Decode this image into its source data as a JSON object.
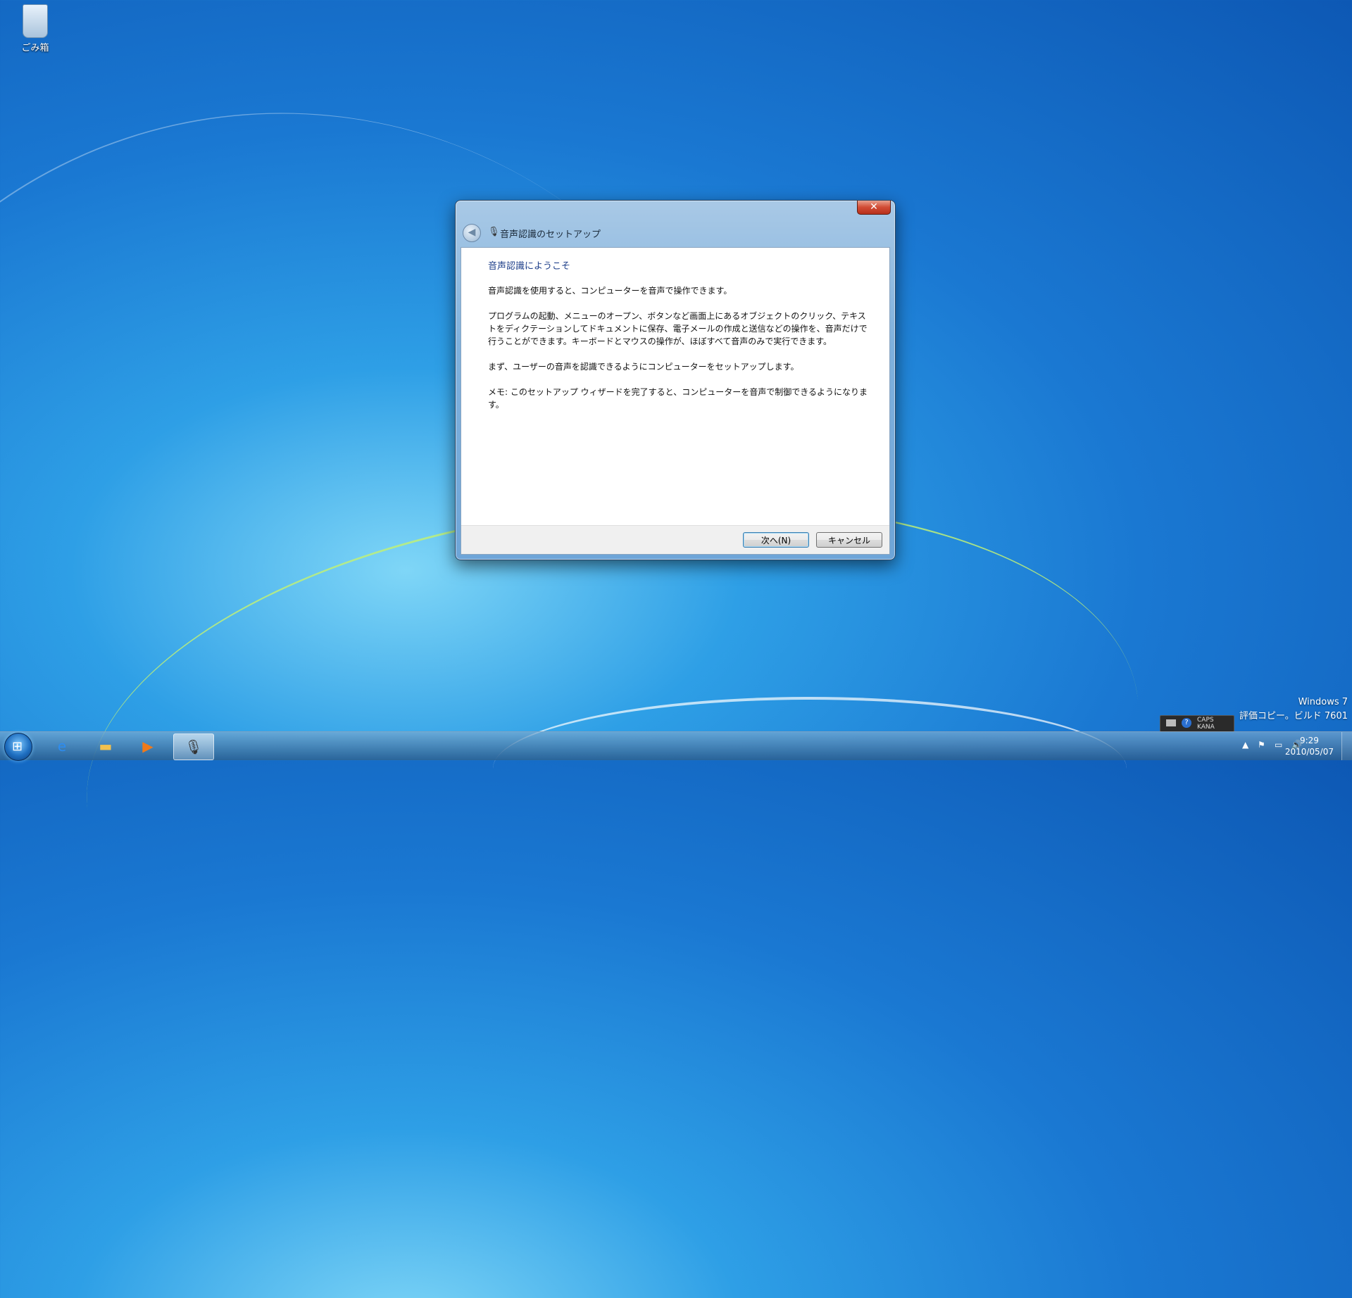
{
  "desktop": {
    "recycle_bin_label": "ごみ箱"
  },
  "dialog": {
    "title": "音声認識のセットアップ",
    "close_symbol": "✕",
    "back_symbol": "◀",
    "heading": "音声認識にようこそ",
    "paragraphs": [
      "音声認識を使用すると、コンピューターを音声で操作できます。",
      "プログラムの起動、メニューのオープン、ボタンなど画面上にあるオブジェクトのクリック、テキストをディクテーションしてドキュメントに保存、電子メールの作成と送信などの操作を、音声だけで行うことができます。キーボードとマウスの操作が、ほぼすべて音声のみで実行できます。",
      "まず、ユーザーの音声を認識できるようにコンピューターをセットアップします。",
      "メモ: このセットアップ ウィザードを完了すると、コンピューターを音声で制御できるようになります。"
    ],
    "next_button": "次へ(N)",
    "cancel_button": "キャンセル"
  },
  "language_bar": {
    "caps": "CAPS",
    "kana": "KANA",
    "help": "?"
  },
  "watermark": {
    "line1": "Windows 7",
    "line2": "評価コピー。ビルド 7601"
  },
  "taskbar": {
    "clock_time": "9:29",
    "clock_date": "2010/05/07"
  }
}
